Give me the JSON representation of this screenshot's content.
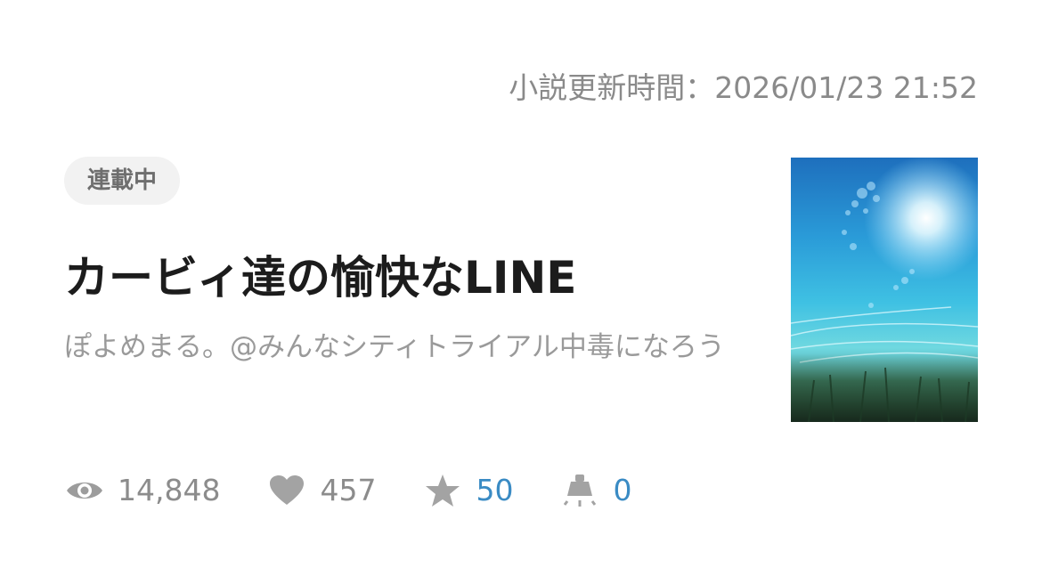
{
  "novel": {
    "updated_text": "小説更新時間：2026/01/23 21:52",
    "status_badge": "連載中",
    "title": "カービィ達の愉快なLINE",
    "author": "ぽよめまる。@みんなシティトライアル中毒になろう",
    "cover_icon": "sky-sun-grass-cover-image"
  },
  "stats": {
    "views": "14,848",
    "likes": "457",
    "stars": "50",
    "comments": "0"
  },
  "colors": {
    "grey_text": "#8c8c8c",
    "blue_text": "#3a8bc4",
    "badge_bg": "#f2f2f2",
    "title_text": "#1c1c1c"
  }
}
